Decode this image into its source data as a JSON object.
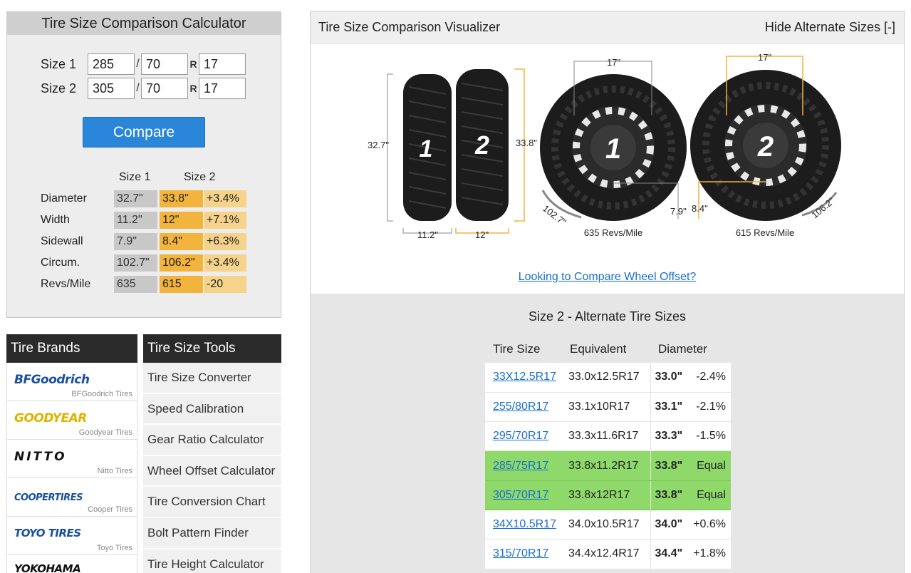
{
  "calculator": {
    "title": "Tire Size Comparison Calculator",
    "size1": {
      "label": "Size 1",
      "width": "285",
      "aspect": "70",
      "rim": "17"
    },
    "size2": {
      "label": "Size 2",
      "width": "305",
      "aspect": "70",
      "rim": "17"
    },
    "sep": "/",
    "r_label": "R",
    "compare_label": "Compare",
    "col1": "Size 1",
    "col2": "Size 2",
    "rows": [
      {
        "metric": "Diameter",
        "v1": "32.7\"",
        "v2": "33.8\"",
        "diff": "+3.4%"
      },
      {
        "metric": "Width",
        "v1": "11.2\"",
        "v2": "12\"",
        "diff": "+7.1%"
      },
      {
        "metric": "Sidewall",
        "v1": "7.9\"",
        "v2": "8.4\"",
        "diff": "+6.3%"
      },
      {
        "metric": "Circum.",
        "v1": "102.7\"",
        "v2": "106.2\"",
        "diff": "+3.4%"
      },
      {
        "metric": "Revs/Mile",
        "v1": "635",
        "v2": "615",
        "diff": "-20"
      }
    ]
  },
  "brands": {
    "title": "Tire Brands",
    "items": [
      {
        "logo": "BFGoodrich",
        "name": "BFGoodrich Tires",
        "color": "#1a4fa0"
      },
      {
        "logo": "GOODYEAR",
        "name": "Goodyear Tires",
        "color": "#e0b200"
      },
      {
        "logo": "NITTO",
        "name": "Nitto Tires",
        "color": "#111111"
      },
      {
        "logo": "COOPERTIRES",
        "name": "Cooper Tires",
        "color": "#1a4fa0"
      },
      {
        "logo": "TOYO TIRES",
        "name": "Toyo Tires",
        "color": "#1a4fa0"
      },
      {
        "logo": "YOKOHAMA",
        "name": "",
        "color": "#111111"
      }
    ]
  },
  "tools": {
    "title": "Tire Size Tools",
    "items": [
      "Tire Size Converter",
      "Speed Calibration",
      "Gear Ratio Calculator",
      "Wheel Offset Calculator",
      "Tire Conversion Chart",
      "Bolt Pattern Finder",
      "Tire Height Calculator"
    ]
  },
  "visualizer": {
    "title": "Tire Size Comparison Visualizer",
    "toggle": "Hide Alternate Sizes [-]",
    "tire1_num": "1",
    "tire2_num": "2",
    "dia1": "32.7\"",
    "dia2": "33.8\"",
    "width1": "11.2\"",
    "width2": "12\"",
    "rim1": "17\"",
    "rim2": "17\"",
    "side1": "7.9\"",
    "side2": "8.4\"",
    "circ1": "102.7\"",
    "circ2": "106.2\"",
    "revs1": "635 Revs/Mile",
    "revs2": "615 Revs/Mile",
    "offset_link": "Looking to Compare Wheel Offset?"
  },
  "alternates": {
    "title": "Size 2 - Alternate Tire Sizes",
    "headers": [
      "Tire Size",
      "Equivalent",
      "Diameter"
    ],
    "rows": [
      {
        "size": "33X12.5R17",
        "equiv": "33.0x12.5R17",
        "dia": "33.0\"",
        "diff": "-2.4%",
        "equal": false
      },
      {
        "size": "255/80R17",
        "equiv": "33.1x10R17",
        "dia": "33.1\"",
        "diff": "-2.1%",
        "equal": false
      },
      {
        "size": "295/70R17",
        "equiv": "33.3x11.6R17",
        "dia": "33.3\"",
        "diff": "-1.5%",
        "equal": false
      },
      {
        "size": "285/75R17",
        "equiv": "33.8x11.2R17",
        "dia": "33.8\"",
        "diff": "Equal",
        "equal": true
      },
      {
        "size": "305/70R17",
        "equiv": "33.8x12R17",
        "dia": "33.8\"",
        "diff": "Equal",
        "equal": true
      },
      {
        "size": "34X10.5R17",
        "equiv": "34.0x10.5R17",
        "dia": "34.0\"",
        "diff": "+0.6%",
        "equal": false
      },
      {
        "size": "315/70R17",
        "equiv": "34.4x12.4R17",
        "dia": "34.4\"",
        "diff": "+1.8%",
        "equal": false
      }
    ]
  },
  "colors": {
    "accent": "#2a86d8",
    "size2": "#f2b43c",
    "equal_row": "#8ed96a",
    "link": "#1a6ed0"
  }
}
